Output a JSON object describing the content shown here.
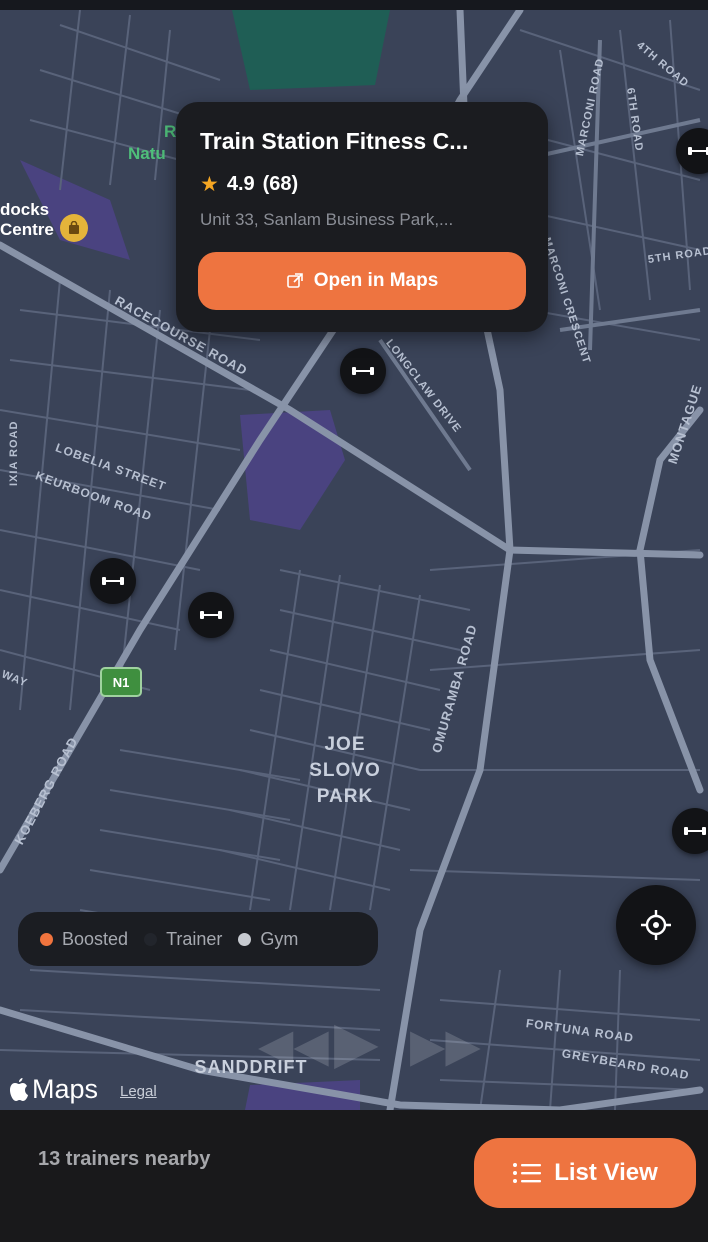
{
  "map": {
    "street_labels": [
      "RACECOURSE ROAD",
      "LOBELIA STREET",
      "KEURBOOM ROAD",
      "KOEBERG ROAD",
      "OMURAMBA ROAD",
      "MONTAGUE",
      "MARCONI ROAD",
      "4TH ROAD",
      "6TH ROAD",
      "5TH ROAD",
      "MARCONI CRESCENT",
      "LONGCLAW DRIVE",
      "FORTUNA ROAD",
      "GREYBEARD ROAD",
      "IXIA ROAD",
      "WAY"
    ],
    "park_label": "JOE SLOVO\nPARK",
    "area_label": "SANDDRIFT",
    "poi_mall_label": "docks\nCentre",
    "poi_nature_label": "Natu",
    "poi_nature_initial": "R",
    "route_shield": "N1"
  },
  "callout": {
    "title": "Train Station Fitness C...",
    "rating": "4.9",
    "review_count": "(68)",
    "address": "Unit 33, Sanlam Business Park,...",
    "open_button_label": "Open in Maps",
    "star_icon": "star-icon",
    "external_link_icon": "external-link-icon"
  },
  "legend": {
    "items": [
      {
        "label": "Boosted",
        "color": "#f0743e"
      },
      {
        "label": "Trainer",
        "color": "#22252c"
      },
      {
        "label": "Gym",
        "color": "#c7cad0"
      }
    ]
  },
  "map_brand": {
    "label": "Maps",
    "legal": "Legal"
  },
  "bottom": {
    "nearby_text": "13 trainers nearby",
    "list_view_label": "List View"
  },
  "colors": {
    "accent": "#ee7440",
    "map_bg": "#3a4358",
    "street": "#7c879c",
    "park": "#4a4380",
    "water_green": "#1f5e55"
  },
  "pins": {
    "icon": "dumbbell-icon",
    "count": 5
  }
}
